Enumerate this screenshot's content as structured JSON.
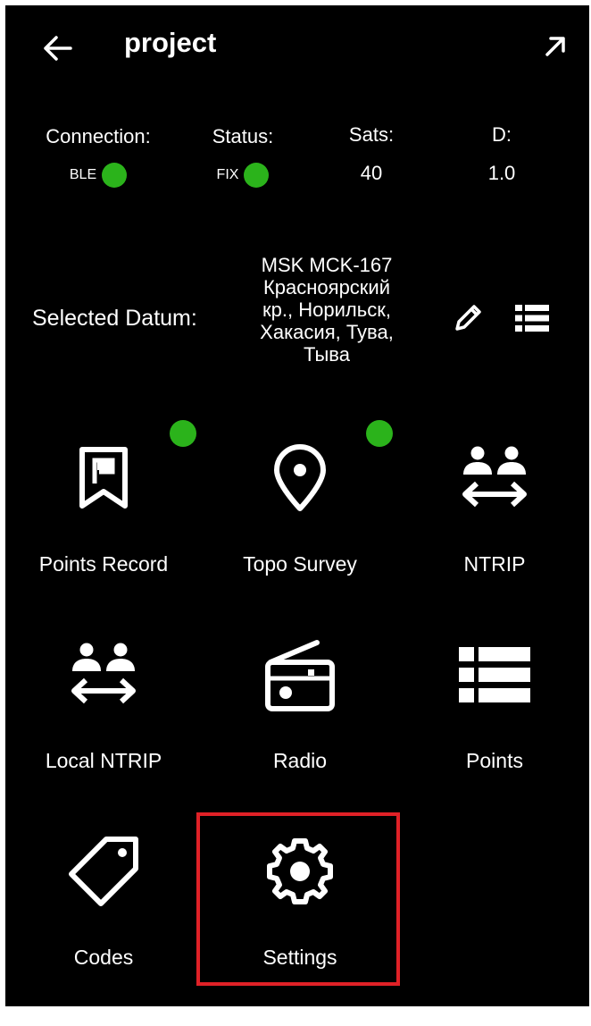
{
  "header": {
    "title": "project",
    "back_icon": "arrow-left-icon",
    "expand_icon": "arrow-up-right-icon"
  },
  "status_bar": {
    "connection": {
      "label": "Connection:",
      "value": "BLE",
      "indicator_color": "#2bb31b"
    },
    "status": {
      "label": "Status:",
      "value": "FIX",
      "indicator_color": "#2bb31b"
    },
    "sats": {
      "label": "Sats:",
      "value": "40"
    },
    "d": {
      "label": "D:",
      "value": "1.0"
    }
  },
  "datum": {
    "label": "Selected Datum:",
    "value_lines": [
      "MSK MCK-167",
      "Красноярский",
      "кр., Норильск,",
      "Хакасия, Тува,",
      "Тыва"
    ],
    "edit_icon": "pencil-icon",
    "list_icon": "list-icon"
  },
  "menu": {
    "points_record": {
      "label": "Points Record",
      "icon": "flag-bookmark-icon",
      "active": true
    },
    "topo_survey": {
      "label": "Topo Survey",
      "icon": "map-pin-icon",
      "active": true
    },
    "ntrip": {
      "label": "NTRIP",
      "icon": "users-exchange-icon"
    },
    "local_ntrip": {
      "label": "Local NTRIP",
      "icon": "users-exchange-icon"
    },
    "radio": {
      "label": "Radio",
      "icon": "radio-icon"
    },
    "points": {
      "label": "Points",
      "icon": "list-icon"
    },
    "codes": {
      "label": "Codes",
      "icon": "tag-icon"
    },
    "settings": {
      "label": "Settings",
      "icon": "gear-icon",
      "highlighted": true
    }
  },
  "colors": {
    "background": "#000000",
    "foreground": "#ffffff",
    "indicator": "#2bb31b",
    "highlight": "#e02127"
  }
}
